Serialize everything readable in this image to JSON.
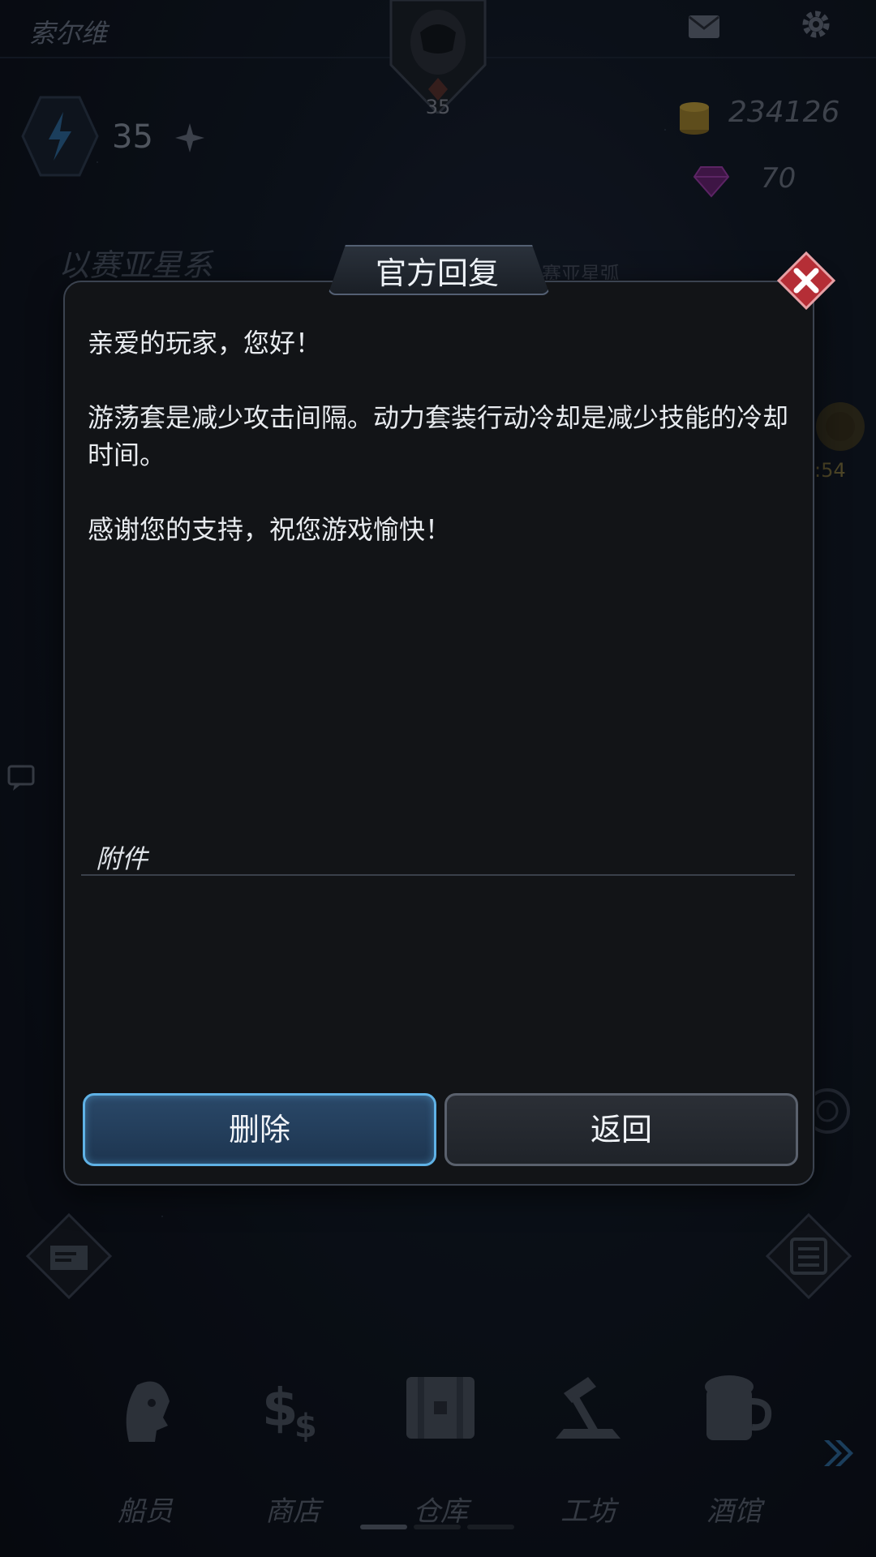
{
  "hud": {
    "player_name": "索尔维",
    "avatar_level": "35",
    "energy": "35",
    "coins": "234126",
    "gems": "70",
    "system_name": "以赛亚星系",
    "system_sub": "赛亚星弧",
    "timer": ":54"
  },
  "bottom_nav": {
    "items": [
      {
        "label": "船员",
        "icon": "crew-icon"
      },
      {
        "label": "商店",
        "icon": "shop-icon"
      },
      {
        "label": "仓库",
        "icon": "warehouse-icon"
      },
      {
        "label": "工坊",
        "icon": "workshop-icon"
      },
      {
        "label": "酒馆",
        "icon": "tavern-icon"
      }
    ]
  },
  "dialog": {
    "title": "官方回复",
    "greeting": "亲爱的玩家，您好！",
    "body": "游荡套是减少攻击间隔。动力套装行动冷却是减少技能的冷却时间。",
    "closing": "感谢您的支持，祝您游戏愉快！",
    "attachment_label": "附件",
    "delete_label": "删除",
    "back_label": "返回"
  },
  "colors": {
    "accent_blue": "#5fb2e6",
    "close_red": "#c0343b",
    "coin_gold": "#c8a43a",
    "gem_purple": "#8a2b8f"
  }
}
